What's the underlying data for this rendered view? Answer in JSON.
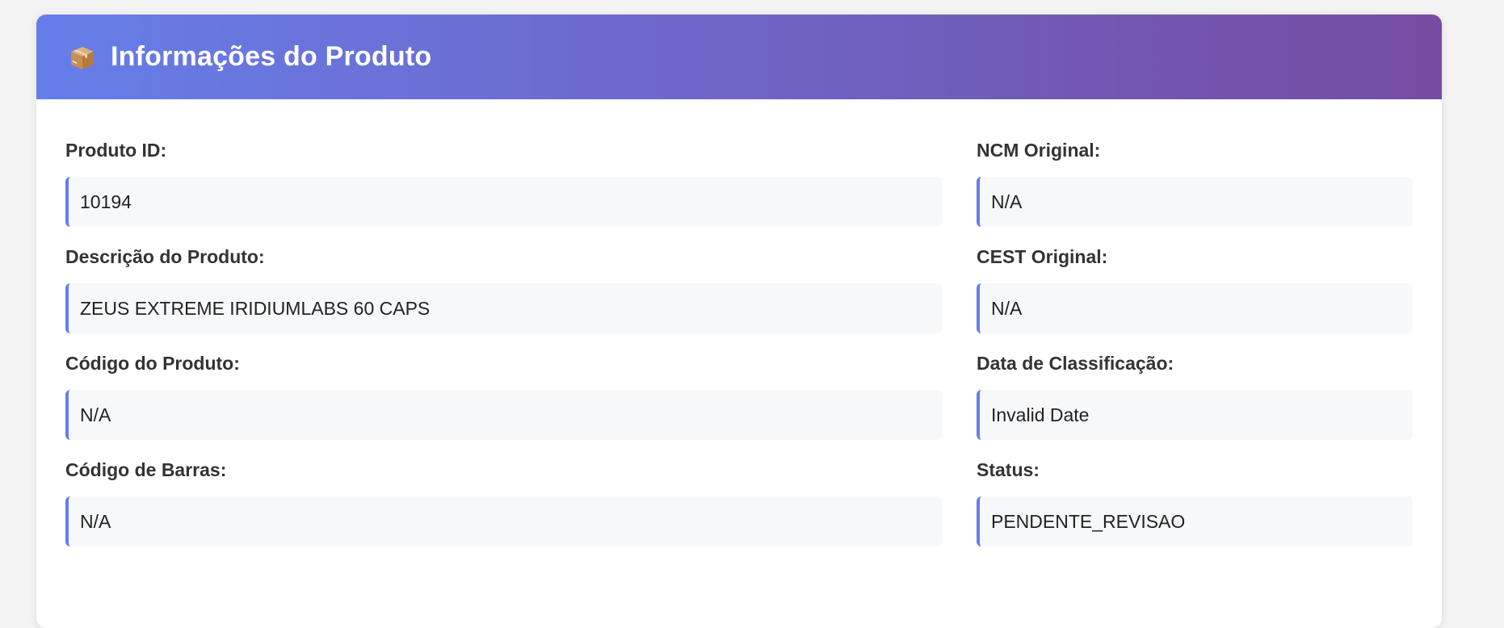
{
  "header": {
    "icon": "package-icon",
    "title": "Informações do Produto"
  },
  "colors": {
    "gradient_start": "#667eea",
    "gradient_end": "#764ba2",
    "accent": "#667eea",
    "field_background": "#f7f8fa"
  },
  "left_fields": [
    {
      "label": "Produto ID:",
      "value": "10194"
    },
    {
      "label": "Descrição do Produto:",
      "value": "ZEUS EXTREME IRIDIUMLABS 60 CAPS"
    },
    {
      "label": "Código do Produto:",
      "value": "N/A"
    },
    {
      "label": "Código de Barras:",
      "value": "N/A"
    }
  ],
  "right_fields": [
    {
      "label": "NCM Original:",
      "value": "N/A"
    },
    {
      "label": "CEST Original:",
      "value": "N/A"
    },
    {
      "label": "Data de Classificação:",
      "value": "Invalid Date"
    },
    {
      "label": "Status:",
      "value": "PENDENTE_REVISAO"
    }
  ]
}
